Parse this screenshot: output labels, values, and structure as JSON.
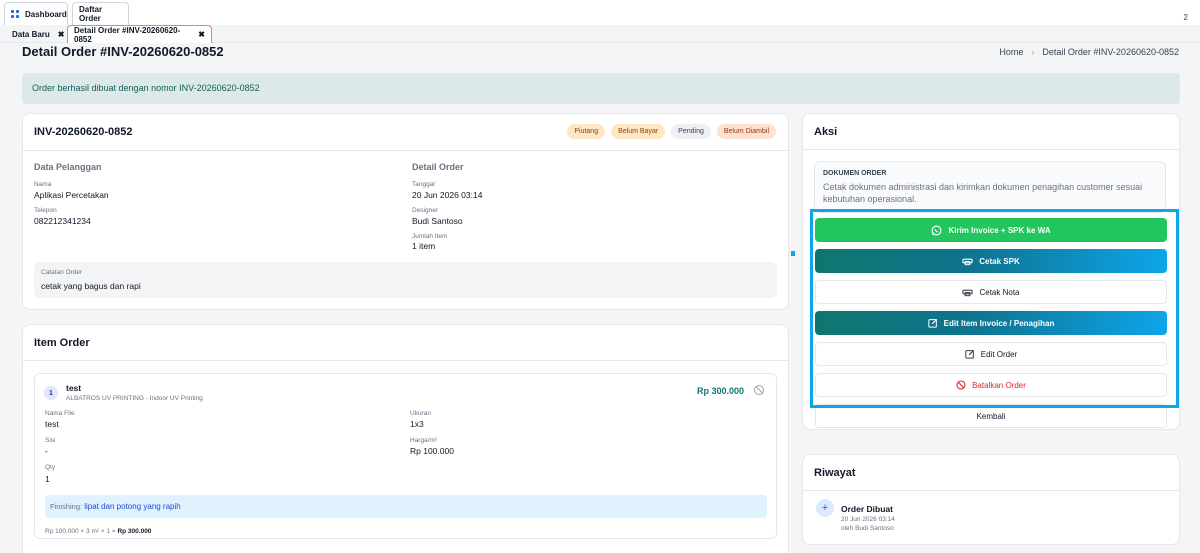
{
  "topbar": {
    "tabs": [
      {
        "label": "Dashboard"
      },
      {
        "label": "Daftar Order"
      }
    ],
    "number": "2"
  },
  "subtabs": [
    {
      "label": "Data Baru",
      "close": "✖"
    },
    {
      "label": "Detail Order #INV-20260620-0852",
      "close": "✖"
    }
  ],
  "page": {
    "title": "Detail Order #INV-20260620-0852",
    "breadcrumb": {
      "home": "Home",
      "current": "Detail Order #INV-20260620-0852"
    }
  },
  "alert": "Order berhasil dibuat dengan nomor INV-20260620-0852",
  "order": {
    "invoice": "INV-20260620-0852",
    "badges": [
      "Piutang",
      "Belum Bayar",
      "Pending",
      "Belum Diambil"
    ],
    "customer": {
      "section": "Data Pelanggan",
      "name_label": "Nama",
      "name": "Aplikasi Percetakan",
      "phone_label": "Telepon",
      "phone": "082212341234"
    },
    "detail": {
      "section": "Detail Order",
      "date_label": "Tanggal",
      "date": "20 Jun 2026 03:14",
      "designer_label": "Designer",
      "designer": "Budi Santoso",
      "qty_label": "Jumlah Item",
      "qty": "1 item"
    },
    "notes_label": "Catatan Order",
    "notes": "cetak yang bagus dan rapi"
  },
  "items": {
    "title": "Item Order",
    "list": [
      {
        "num": "1",
        "name": "test",
        "source_bold": "ALBATROS UV PRINTING",
        "source_rest": " - Indoor UV Printing",
        "price": "Rp 300.000",
        "file_label": "Nama File",
        "file": "test",
        "size_label": "Ukuran",
        "size": "1x3",
        "side_label": "Sisi",
        "side": "-",
        "rate_label": "Harga/m²",
        "rate": "Rp 100.000",
        "qty_label": "Qty",
        "qty": "1",
        "finishing_label": "Finishing:",
        "finishing": "lipat dan potong yang rapih",
        "calc": "Rp 100.000 × 3 m² × 1 = ",
        "calc_total": "Rp 300.000"
      }
    ]
  },
  "actions": {
    "title": "Aksi",
    "doc_title": "DOKUMEN ORDER",
    "doc_desc": "Cetak dokumen administrasi dan kirimkan dokumen penagihan customer sesuai kebutuhan operasional.",
    "buttons": {
      "wa": "Kirim Invoice + SPK ke WA",
      "spk": "Cetak SPK",
      "nota": "Cetak Nota",
      "edit_invoice": "Edit Item Invoice / Penagihan",
      "edit_order": "Edit Order",
      "cancel": "Batalkan Order",
      "back": "Kembali"
    }
  },
  "history": {
    "title": "Riwayat",
    "events": [
      {
        "title": "Order Dibuat",
        "time": "20 Jun 2026 03:14",
        "by": "oleh Budi Santoso"
      }
    ]
  },
  "colors": {
    "accent": "#0ea5e9",
    "whatsapp": "#22c55e",
    "danger": "#dc2626",
    "teal": "#0f766e"
  }
}
